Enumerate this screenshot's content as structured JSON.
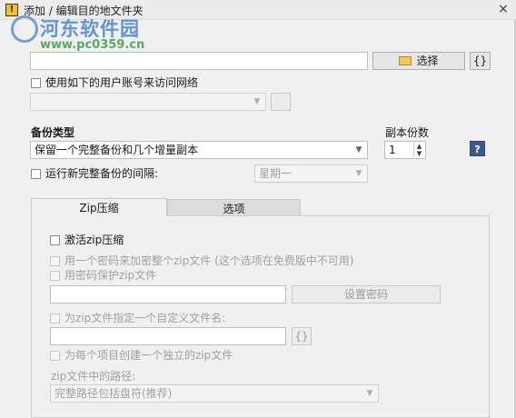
{
  "window": {
    "title": "添加 / 编辑目的地文件夹",
    "close_glyph": "×"
  },
  "watermark": {
    "name": "河东软件园",
    "url": "www.pc0359.cn"
  },
  "folder": {
    "path_value": "",
    "choose_button": "选择",
    "braces_button": "{}"
  },
  "network": {
    "use_account_label": "使用如下的用户账号来访问网络",
    "account_value": "",
    "checked": false
  },
  "backup": {
    "type_label": "备份类型",
    "type_value": "保留一个完整备份和几个增量副本",
    "copies_label": "副本份数",
    "copies_value": "1",
    "help_glyph": "?",
    "full_interval_label": "运行新完整备份的间隔:",
    "full_interval_checked": false,
    "weekday_value": "星期一"
  },
  "tabs": [
    {
      "label": "Zip压缩",
      "active": true
    },
    {
      "label": "选项",
      "active": false
    }
  ],
  "zip": {
    "activate_label": "激活zip压缩",
    "activate_checked": false,
    "encrypt_label": "用一个密码来加密整个zip文件 (这个选项在免费版中不可用)",
    "protect_label": "用密码保护zip文件",
    "password_value": "",
    "set_password_button": "设置密码",
    "custom_name_label": "为zip文件指定一个自定义文件名:",
    "custom_name_value": "",
    "custom_braces_button": "{}",
    "per_item_label": "为每个项目创建一个独立的zip文件",
    "path_label": "zip文件中的路径:",
    "path_value": "完整路径包括盘符(推荐)"
  }
}
